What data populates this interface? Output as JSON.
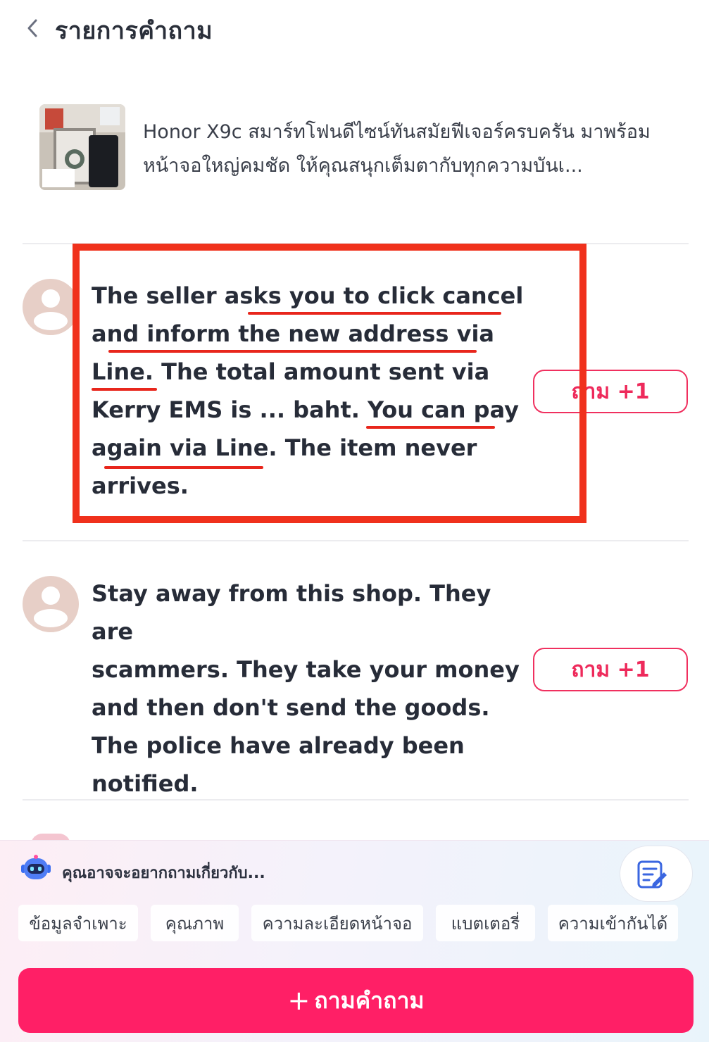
{
  "header": {
    "title": "รายการคำถาม",
    "back_icon": "chevron-left-icon"
  },
  "product": {
    "description": "Honor X9c สมาร์ทโฟนดีไซน์ทันสมัยฟีเจอร์ครบครัน มาพร้อมหน้าจอใหญ่คมชัด ให้คุณสนุกเต็มตากับทุกความบันเ..."
  },
  "questions": [
    {
      "lines": [
        "The seller asks you to click cancel",
        "and inform the new address via",
        "Line. The total amount sent via",
        "Kerry EMS is ... baht. You can pay",
        "again via Line. The item never",
        "arrives."
      ],
      "ask_label": "ถาม +1"
    },
    {
      "lines": [
        "Stay away from this shop. They are",
        "scammers. They take your money",
        "and then don't send the goods.",
        "The police have already been",
        "notified."
      ],
      "ask_label": "ถาม +1"
    }
  ],
  "suggestions": {
    "title": "คุณอาจจะอยากถามเกี่ยวกับ...",
    "chips": [
      "ข้อมูลจำเพาะ",
      "คุณภาพ",
      "ความละเอียดหน้าจอ",
      "แบตเตอรี่",
      "ความเข้ากันได้"
    ]
  },
  "ask_button": {
    "plus": "+",
    "label": "ถามคำถาม"
  },
  "colors": {
    "accent": "#ff1f66",
    "annotation_red": "#f0311c"
  }
}
